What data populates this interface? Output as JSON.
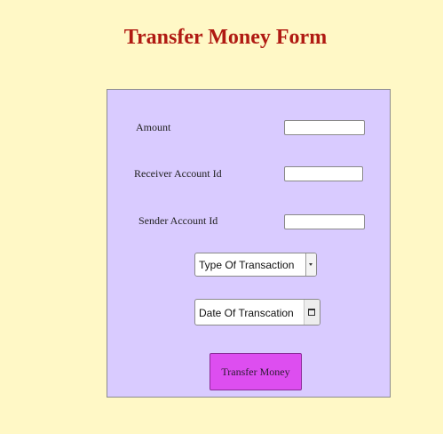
{
  "page": {
    "title": "Transfer Money Form"
  },
  "form": {
    "amount": {
      "label": "Amount",
      "value": ""
    },
    "receiver_account": {
      "label": "Receiver Account Id",
      "value": ""
    },
    "sender_account": {
      "label": "Sender Account Id",
      "value": ""
    },
    "transaction_type": {
      "selected": "Type Of Transaction"
    },
    "transaction_date": {
      "placeholder": "Date Of Transcation",
      "icon": "calendar-icon"
    },
    "submit_label": "Transfer Money"
  },
  "colors": {
    "page_background": "#fff8c6",
    "title": "#b01a12",
    "panel_background": "#d9cbff",
    "button_background": "#dd4ef0"
  }
}
